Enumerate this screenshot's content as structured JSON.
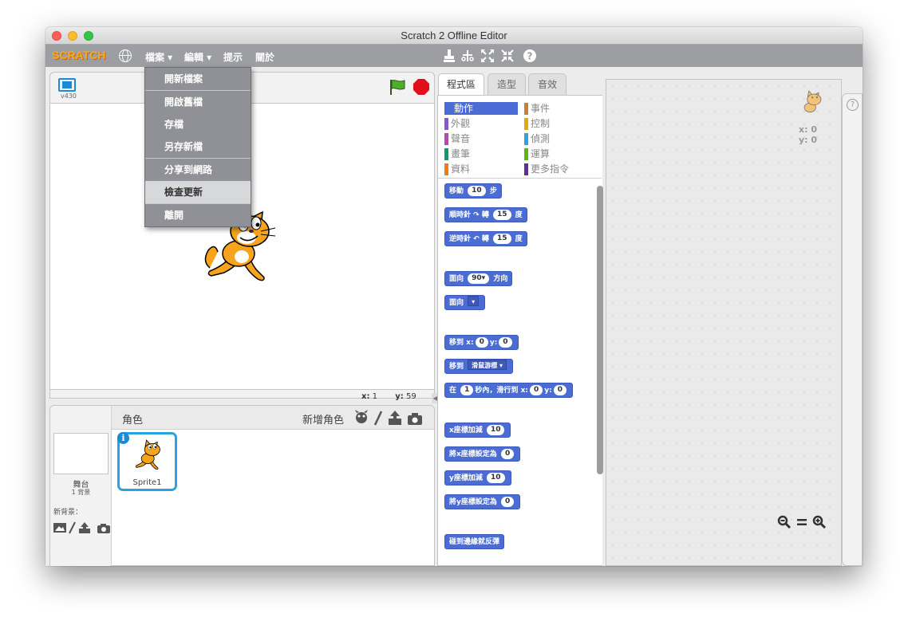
{
  "window": {
    "title": "Scratch 2 Offline Editor"
  },
  "menubar": {
    "logo": "SCRATCH",
    "menus": [
      "檔案 ▾",
      "編輯 ▾",
      "提示",
      "關於"
    ]
  },
  "file_menu": {
    "items": [
      "開新檔案",
      "開啟舊檔",
      "存檔",
      "另存新檔",
      "分享到網路",
      "檢查更新",
      "離開"
    ],
    "hovered": "檢查更新"
  },
  "stage": {
    "version": "v430",
    "x_label": "x:",
    "x_value": "1",
    "y_label": "y:",
    "y_value": "59"
  },
  "sprites_panel": {
    "sprites_label": "角色",
    "new_sprite_label": "新增角色",
    "stage_label": "舞台",
    "backdrop_count": "1 背景",
    "new_backdrop_label": "新背景：",
    "sprite_name": "Sprite1"
  },
  "tabs": [
    "程式區",
    "造型",
    "音效"
  ],
  "categories": {
    "left": [
      {
        "name": "動作",
        "color": "#4a6cd4"
      },
      {
        "name": "外觀",
        "color": "#8a55d7"
      },
      {
        "name": "聲音",
        "color": "#bb42c3"
      },
      {
        "name": "畫筆",
        "color": "#0e9a6c"
      },
      {
        "name": "資料",
        "color": "#ee7d16"
      }
    ],
    "right": [
      {
        "name": "事件",
        "color": "#c88330"
      },
      {
        "name": "控制",
        "color": "#e1a91a"
      },
      {
        "name": "偵測",
        "color": "#2ca5e2"
      },
      {
        "name": "運算",
        "color": "#5cb712"
      },
      {
        "name": "更多指令",
        "color": "#632d99"
      }
    ]
  },
  "blocks": {
    "move": {
      "pre": "移動",
      "value": "10",
      "post": "步"
    },
    "turn_cw": {
      "pre": "順時針",
      "mid": "轉",
      "value": "15",
      "post": "度"
    },
    "turn_ccw": {
      "pre": "逆時針",
      "mid": "轉",
      "value": "15",
      "post": "度"
    },
    "point_dir": {
      "pre": "面向",
      "value": "90▾",
      "post": "方向"
    },
    "point_towards": {
      "pre": "面向",
      "value": "▾"
    },
    "goto_xy": {
      "pre": "移到",
      "x_label": "x:",
      "x": "0",
      "y_label": "y:",
      "y": "0"
    },
    "goto": {
      "pre": "移到",
      "value": "滑鼠游標 ▾"
    },
    "glide": {
      "pre": "在",
      "secs": "1",
      "mid": "秒內，滑行到",
      "x_label": "x:",
      "x": "0",
      "y_label": "y:",
      "y": "0"
    },
    "change_x": {
      "pre": "x座標加減",
      "value": "10"
    },
    "set_x": {
      "pre": "將x座標設定為",
      "value": "0"
    },
    "change_y": {
      "pre": "y座標加減",
      "value": "10"
    },
    "set_y": {
      "pre": "將y座標設定為",
      "value": "0"
    },
    "bounce": {
      "pre": "碰到邊緣就反彈"
    }
  },
  "script_area": {
    "x_readout": "x: 0",
    "y_readout": "y: 0"
  },
  "icons": {
    "zoom_out": "zoom-out-icon",
    "zoom_reset": "zoom-reset-icon",
    "zoom_in": "zoom-in-icon",
    "help": "help-icon"
  }
}
